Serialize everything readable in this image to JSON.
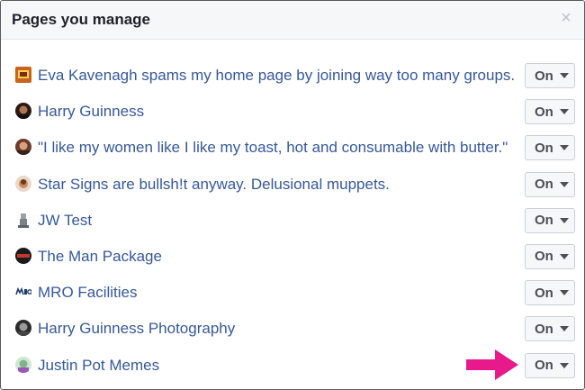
{
  "dialog": {
    "title": "Pages you manage",
    "close_glyph": "×"
  },
  "pages": [
    {
      "name": "Eva Kavenagh spams my home page by joining way too many groups.",
      "status": "On",
      "icon": "page-thumbnail-icon"
    },
    {
      "name": "Harry Guinness",
      "status": "On",
      "icon": "page-thumbnail-icon"
    },
    {
      "name": "\"I like my women like I like my toast, hot and consumable with butter.\"",
      "status": "On",
      "icon": "page-thumbnail-icon"
    },
    {
      "name": "Star Signs are bullsh!t anyway. Delusional muppets.",
      "status": "On",
      "icon": "page-thumbnail-icon"
    },
    {
      "name": "JW Test",
      "status": "On",
      "icon": "page-thumbnail-icon"
    },
    {
      "name": "The Man Package",
      "status": "On",
      "icon": "page-thumbnail-icon"
    },
    {
      "name": "MRO Facilities",
      "status": "On",
      "icon": "page-thumbnail-icon"
    },
    {
      "name": "Harry Guinness Photography",
      "status": "On",
      "icon": "page-thumbnail-icon"
    },
    {
      "name": "Justin Pot Memes",
      "status": "On",
      "icon": "page-thumbnail-icon"
    }
  ],
  "colors": {
    "link": "#365899",
    "highlight_arrow": "#e8198b"
  }
}
